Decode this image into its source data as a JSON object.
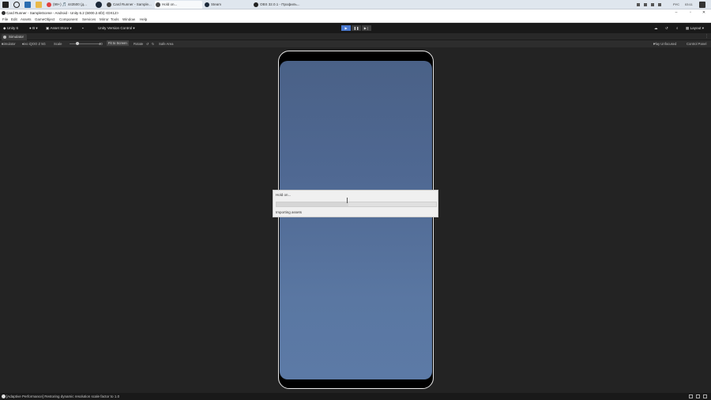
{
  "taskbar": {
    "tabs": [
      {
        "label": "(99+) 🎵 443500 (д...",
        "color": "#e04040"
      },
      {
        "label": "Card Runner - Sample...",
        "color": "#444444"
      },
      {
        "label": "Hold on...",
        "color": "#444444"
      },
      {
        "label": "Steam",
        "color": "#1b2838"
      },
      {
        "label": "OBS 32.0.1 - Профиль...",
        "color": "#222222"
      }
    ],
    "lang": "РУС",
    "time": "03:11"
  },
  "window": {
    "title": "Card Runner - SampleScene - Android - Unity 6.2 (6000.2.6f2) <DX12>"
  },
  "menu": [
    "File",
    "Edit",
    "Assets",
    "GameObject",
    "Component",
    "Services",
    "Mirror",
    "Tools",
    "Window",
    "Help"
  ],
  "toolbar": {
    "unity": "Unity 6",
    "account": "B",
    "asset_store": "Asset Store",
    "version_control": "Unity Version Control",
    "layout": "Layout"
  },
  "simulator": {
    "tab_label": "Simulator",
    "device_dropdown": "Simulator",
    "device": "vivo iQOO Z 5G",
    "scale_label": "Scale",
    "scale_value": "40",
    "fit_button": "Fit to Screen",
    "rotate_label": "Rotate",
    "safe_area": "Safe Area",
    "play_focused": "Play Unfocused",
    "control_panel": "Control Panel"
  },
  "dialog": {
    "title": "Hold on...",
    "message": "Importing assets",
    "progress": 0.45
  },
  "status": {
    "message": "[Adaptive Performance] Restoring dynamic resolution scale factor to 1.0"
  }
}
